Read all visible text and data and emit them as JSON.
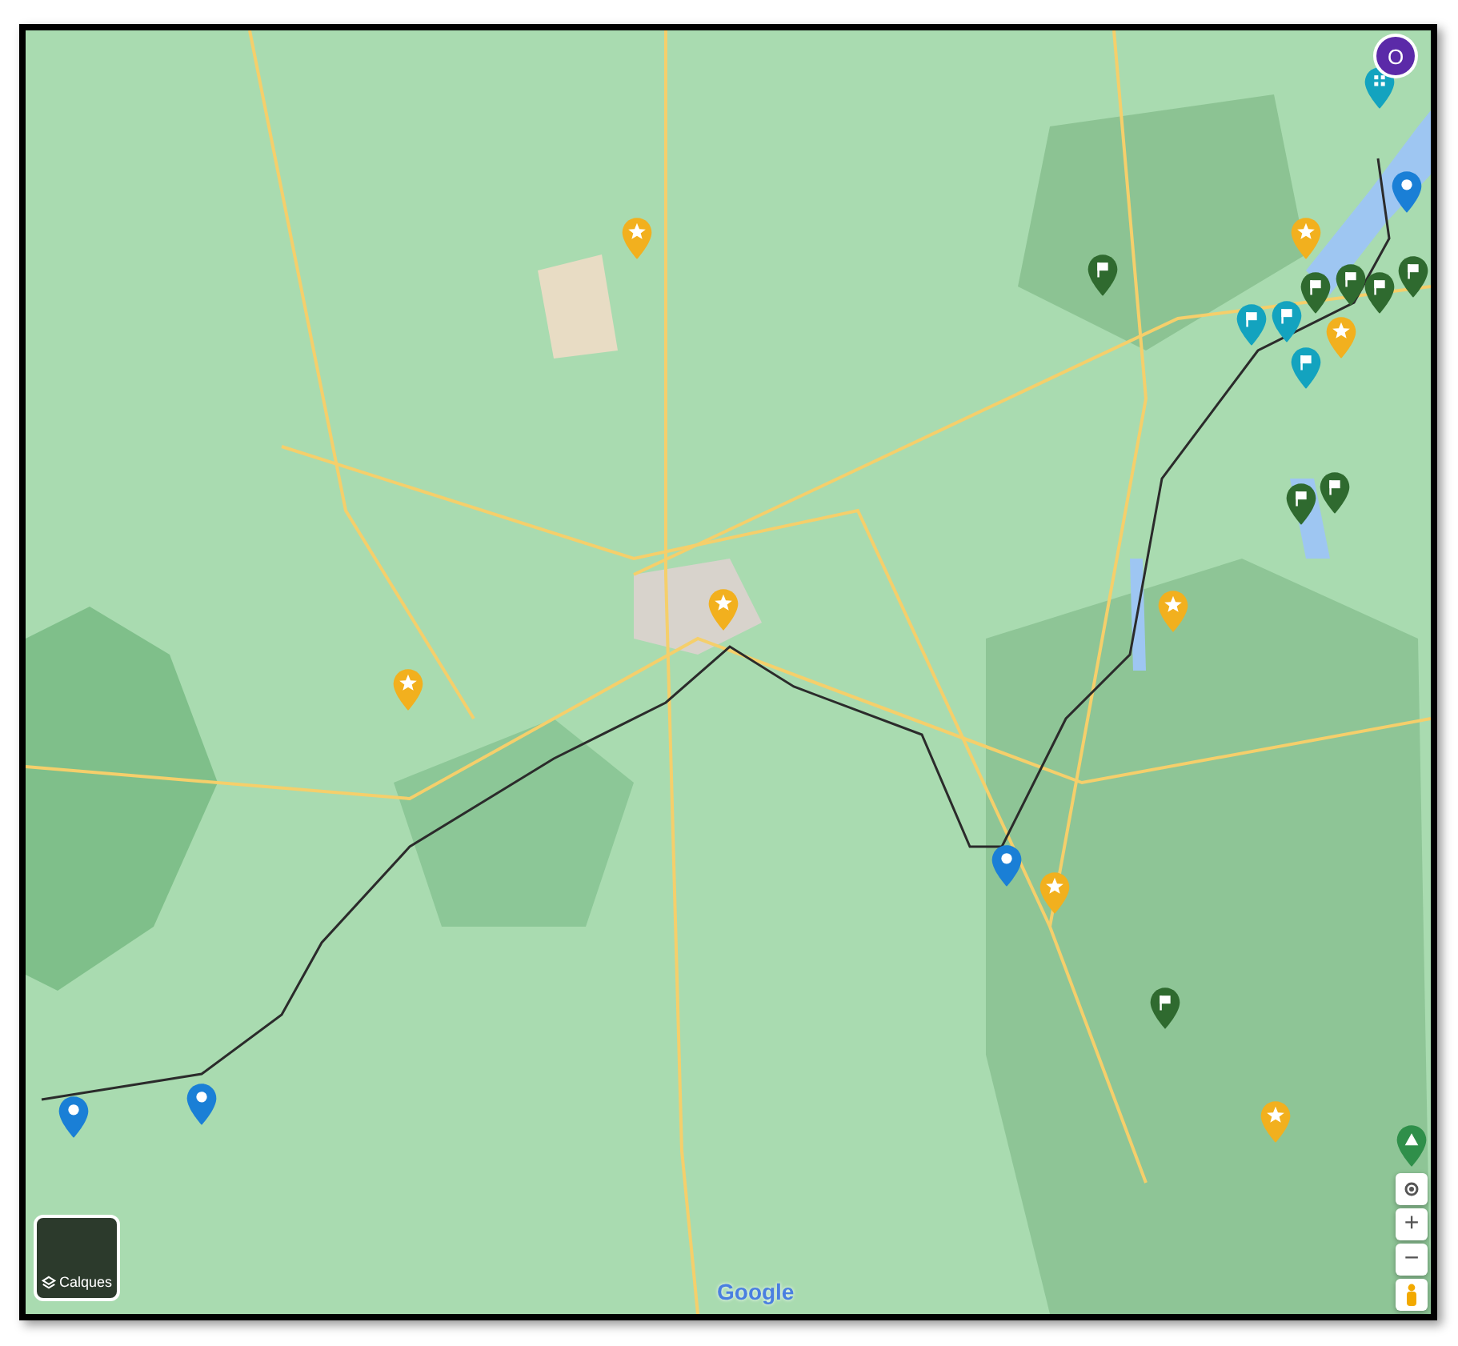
{
  "account": {
    "initial": "O"
  },
  "map": {
    "markers": [
      {
        "kind": "star",
        "color": "#f2b01e"
      },
      {
        "kind": "star",
        "color": "#f2b01e"
      },
      {
        "kind": "star",
        "color": "#f2b01e"
      },
      {
        "kind": "star",
        "color": "#f2b01e"
      },
      {
        "kind": "star",
        "color": "#f2b01e"
      },
      {
        "kind": "star",
        "color": "#f2b01e"
      },
      {
        "kind": "star",
        "color": "#f2b01e"
      },
      {
        "kind": "star",
        "color": "#f2b01e"
      },
      {
        "kind": "pin",
        "color": "#1a7fd6"
      },
      {
        "kind": "pin",
        "color": "#1a7fd6"
      },
      {
        "kind": "pin",
        "color": "#1a7fd6"
      },
      {
        "kind": "pin",
        "color": "#1a7fd6"
      },
      {
        "kind": "flag",
        "color": "#2f6a2f"
      },
      {
        "kind": "flag",
        "color": "#2f6a2f"
      },
      {
        "kind": "flag",
        "color": "#2f6a2f"
      },
      {
        "kind": "flag",
        "color": "#2f6a2f"
      },
      {
        "kind": "flag",
        "color": "#2f6a2f"
      },
      {
        "kind": "flag",
        "color": "#2f6a2f"
      },
      {
        "kind": "flag",
        "color": "#2f6a2f"
      },
      {
        "kind": "flag",
        "color": "#2f6a2f"
      },
      {
        "kind": "flag",
        "color": "#13a3bf"
      },
      {
        "kind": "flag",
        "color": "#13a3bf"
      },
      {
        "kind": "flag",
        "color": "#13a3bf"
      },
      {
        "kind": "grid",
        "color": "#13a3bf"
      },
      {
        "kind": "mountain",
        "color": "#2f8f4a"
      }
    ]
  },
  "layers_button": {
    "label": "Calques"
  },
  "controls": {
    "zoom_in": "+",
    "zoom_out": "−"
  },
  "logo": "Google"
}
